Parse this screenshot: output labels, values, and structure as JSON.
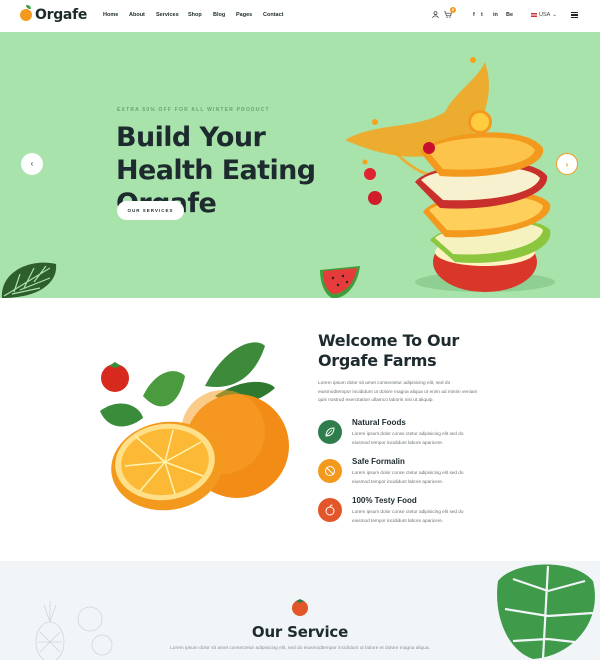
{
  "brand": {
    "name": "Orgafe"
  },
  "nav": {
    "items": [
      "Home",
      "About",
      "Services",
      "Shop",
      "Blog",
      "Pages",
      "Contact"
    ]
  },
  "header": {
    "cart_count": "0",
    "social": [
      "f",
      "t",
      "in",
      "Be"
    ],
    "language": "USA"
  },
  "hero": {
    "eyebrow": "EXTRA 50% OFF FOR ALL WINTER PRODUCT",
    "title": "Build Your Health Eating Orgafe",
    "button": "OUR SERVICES",
    "prev_arrow": "‹",
    "next_arrow": "›"
  },
  "welcome": {
    "title": "Welcome To Our Orgafe Farms",
    "text": "Lorem ipsum dolor sit amet consectetur adipisicing elit, sed do eiusmodtempor incididunt ut dolore magna aliqua ut enim ad minim veniam quis nostrud exercitation ullamco laboris nisi ut aliquip.",
    "features": [
      {
        "title": "Natural Foods",
        "desc": "Lorem ipsum dolor conse ctetur adipisicing elit sed do eiusmod tempor incididunt labore aparicere.",
        "icon": "leaf-icon",
        "color": "#2f7d4c"
      },
      {
        "title": "Safe Formalin",
        "desc": "Lorem ipsum dolor conse ctetur adipisicing elit sed do eiusmod tempor incididunt labore aparicere.",
        "icon": "no-chemical-icon",
        "color": "#f39a1e"
      },
      {
        "title": "100% Testy Food",
        "desc": "Lorem ipsum dolor conse ctetur adipisicing elit sed do eiusmod tempor incididunt labore aparicere.",
        "icon": "fruit-icon",
        "color": "#e2562a"
      }
    ]
  },
  "service": {
    "title": "Our Service",
    "text": "Lorem ipsum dolor sit amet consectetur adipisicing elit, sed do eiusmodtempor incididunt ut labore et dolore magna aliqua."
  },
  "colors": {
    "hero_bg": "#a8e3ac",
    "accent": "#f39a1e",
    "green": "#2f7d4c",
    "red": "#e2562a",
    "service_bg": "#f1f5f8"
  }
}
